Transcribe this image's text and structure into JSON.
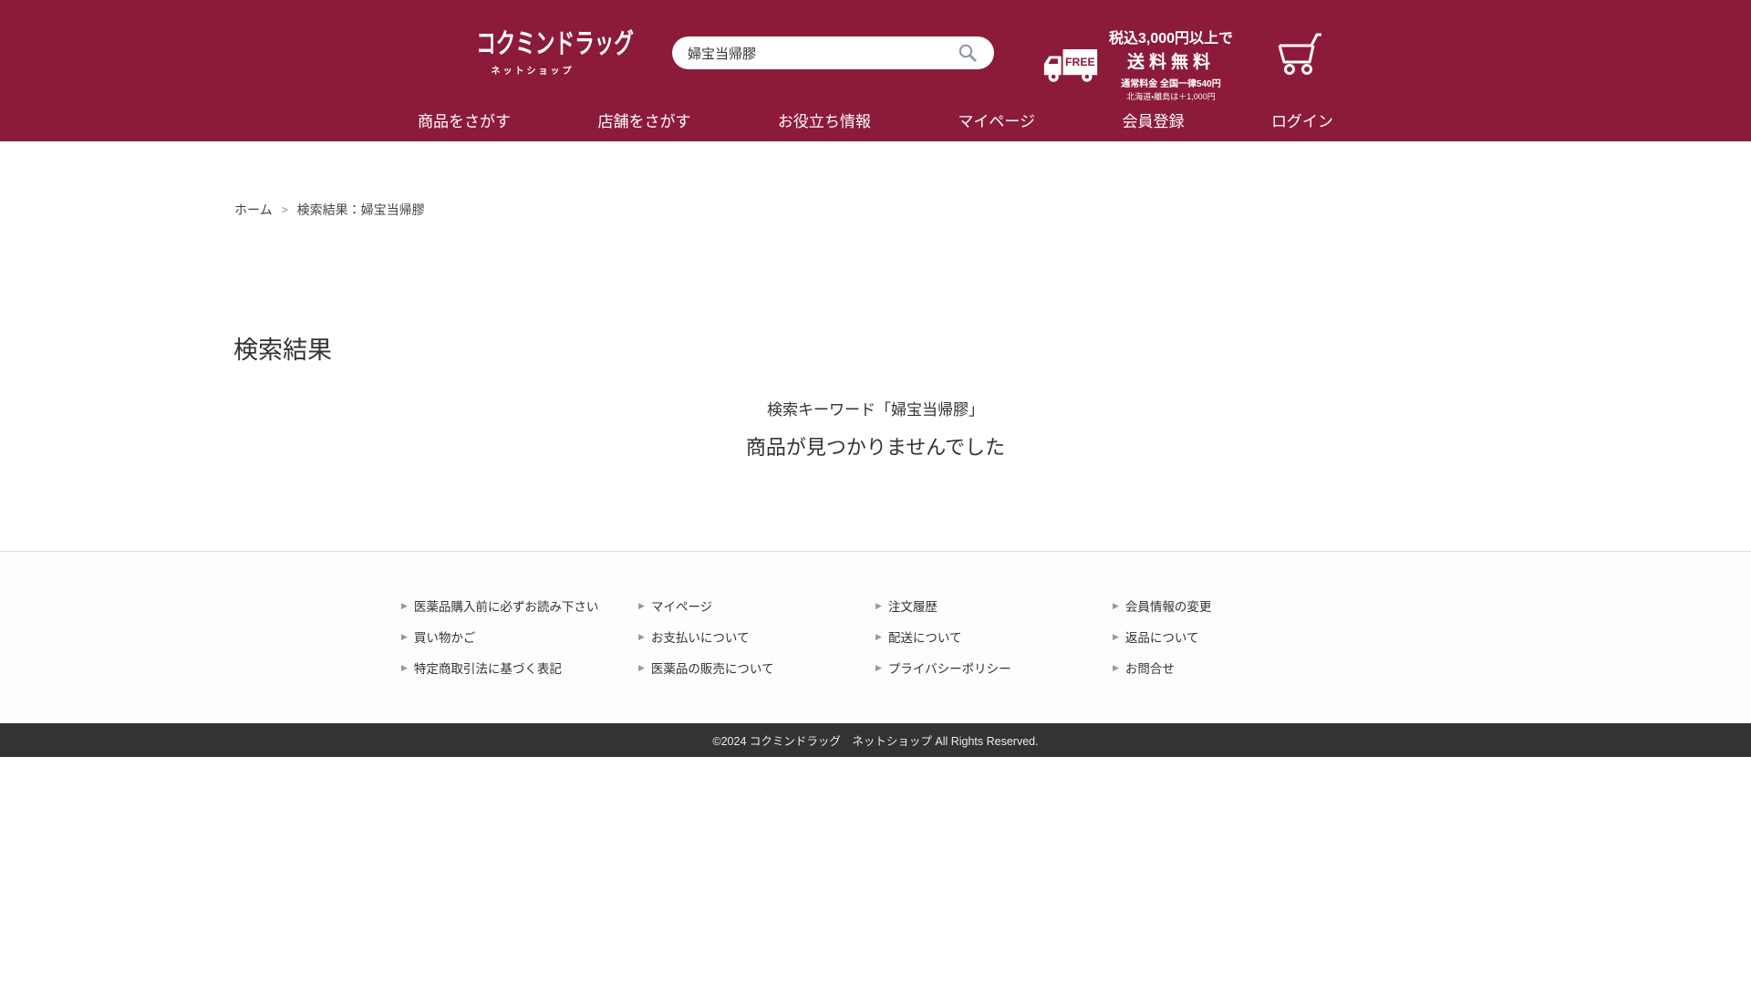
{
  "header": {
    "logo": {
      "title": "コクミンドラッグ",
      "subtitle": "ネットショップ"
    },
    "search": {
      "value": "婦宝当帰膠",
      "icon": "search-icon"
    },
    "shipping": {
      "badge": "FREE",
      "line1": "税込3,000円以上で",
      "line2": "送料無料",
      "line3": "通常料金 全国一律540円",
      "line4": "北海道・離島は＋1,000円"
    },
    "nav": {
      "items": [
        {
          "label": "商品をさがす"
        },
        {
          "label": "店舗をさがす"
        },
        {
          "label": "お役立ち情報"
        },
        {
          "label": "マイページ"
        },
        {
          "label": "会員登録"
        },
        {
          "label": "ログイン"
        }
      ]
    }
  },
  "breadcrumb": {
    "home": "ホーム",
    "separator": ">",
    "current": "検索結果：婦宝当帰膠"
  },
  "main": {
    "title": "検索結果",
    "keyword_line": "検索キーワード「婦宝当帰膠」",
    "no_results": "商品が見つかりませんでした"
  },
  "footer": {
    "columns": [
      {
        "links": [
          "医薬品購入前に必ずお読み下さい",
          "買い物かご",
          "特定商取引法に基づく表記"
        ]
      },
      {
        "links": [
          "マイページ",
          "お支払いについて",
          "医薬品の販売について"
        ]
      },
      {
        "links": [
          "注文履歴",
          "配送について",
          "プライバシーポリシー"
        ]
      },
      {
        "links": [
          "会員情報の変更",
          "返品について",
          "お問合せ"
        ]
      }
    ],
    "copyright": "©2024 コクミンドラッグ　ネットショップ All Rights Reserved."
  },
  "colors": {
    "brand": "#8c1b3a",
    "copyright_bar": "#333333"
  }
}
